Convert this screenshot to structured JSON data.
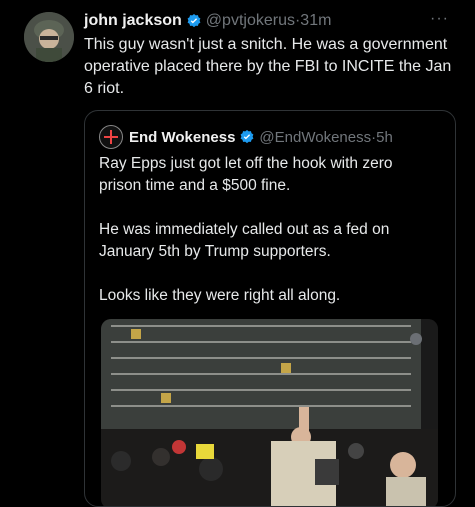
{
  "tweet": {
    "author_name": "john jackson",
    "author_handle": "@pvtjokerus",
    "separator": "·",
    "time": "31m",
    "text": "This guy wasn't just a snitch. He was a government operative placed there by the FBI to INCITE the Jan 6 riot."
  },
  "quote": {
    "author_name": "End Wokeness",
    "author_handle": "@EndWokeness",
    "separator": "·",
    "time": "5h",
    "paragraphs": [
      "Ray Epps just got let off the hook with zero prison time and a $500 fine.",
      "He was immediately called out as a fed on January 5th by Trump supporters.",
      "Looks like they were right all along."
    ]
  },
  "icons": {
    "verified": "verified-badge-icon",
    "more": "more-options-icon"
  },
  "colors": {
    "background": "#000000",
    "text": "#e7e9ea",
    "muted": "#71767b",
    "verified": "#1d9bf0",
    "border": "#2f3336"
  }
}
